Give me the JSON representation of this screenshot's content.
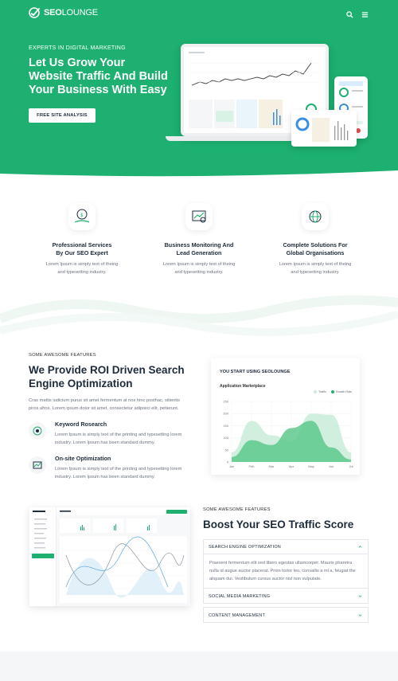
{
  "brand": {
    "name_prefix": "SEO",
    "name_suffix": "LOUNGE",
    "accent": "#1db070",
    "dark": "#1d2b3a"
  },
  "header": {
    "icons": [
      "search-icon",
      "menu-icon"
    ]
  },
  "hero": {
    "kicker": "EXPERTS IN DIGITAL MARKETING",
    "title": "Let Us Grow Your Website Traffic And Build Your Business With Easy",
    "cta": "FREE SITE ANALYSIS"
  },
  "features": [
    {
      "title_1": "Professional Services",
      "title_2": "By Our SEO Expert",
      "desc_1": "Lorem Ipsum is simply text of theing",
      "desc_2": "and typesetting industry.",
      "icon": "money-hand-icon"
    },
    {
      "title_1": "Business Monitoring And",
      "title_2": "Lead Generation",
      "desc_1": "Lorem Ipsum is simply text of theing",
      "desc_2": "and typesetting industry.",
      "icon": "monitoring-search-icon"
    },
    {
      "title_1": "Complete Solutions For",
      "title_2": "Global Organisations",
      "desc_1": "Lorem Ipsum is simply text of theing",
      "desc_2": "and typesetting industry.",
      "icon": "global-target-icon"
    }
  ],
  "roi": {
    "kicker": "SOME AWESOME FEATURES",
    "title_1": "We Provide ROI Driven Search",
    "title_2": "Engine Optimization",
    "para_1": "Cras mattis iudicium purus sit amet fermentum at nos hinc posthac, sitientis",
    "para_2": "piros afros. Lorem ipsum dolor sit amet, consectetur adipisici elit, petierunt.",
    "items": [
      {
        "title": "Keyword Rosearch",
        "desc_1": "Lorem Ipsum is simply text of the printing and typesetting lorem",
        "desc_2": "industry. Lorem Ipsum has been standard dummy.",
        "icon": "keyword-target-icon"
      },
      {
        "title": "On-site Optimization",
        "desc_1": "Lorem Ipsum is simply text of the printing and typesetting lorem",
        "desc_2": "industry. Lorem Ipsum has been standard dummy.",
        "icon": "onsite-chart-icon"
      }
    ]
  },
  "chart_card": {
    "heading": "YOU START USING SEOLOUNGE",
    "subtitle": "Application Marketplace"
  },
  "chart_data": {
    "type": "area",
    "title": "Application Marketplace",
    "categories": [
      "Jan",
      "Feb",
      "Mar",
      "Apr",
      "May",
      "Jun",
      "Jul"
    ],
    "ylim": [
      0,
      250
    ],
    "yticks": [
      0,
      50,
      100,
      150,
      200,
      250
    ],
    "legend_position": "top-right",
    "series": [
      {
        "name": "Traffic",
        "color": "#c9ecd9",
        "values": [
          40,
          170,
          110,
          85,
          200,
          195,
          40
        ]
      },
      {
        "name": "Growth Rate",
        "color": "#5ec98d",
        "values": [
          20,
          90,
          70,
          140,
          170,
          60,
          10
        ]
      }
    ]
  },
  "boost": {
    "kicker": "SOME AWESOME FEATURES",
    "title": "Boost Your SEO Traffic Score",
    "accordion": [
      {
        "label": "SEARCH ENGINE OPTIMIZATION",
        "open": true,
        "body_1": "Praesent fermentum elit sed libero egestas ullamcorper. Mauris pharetra",
        "body_2": "nulla id augue auctor placerat. Proin tortor leo, convallis a mi a, feugiat the",
        "body_3": "aliquam dui. Vestibulum cursus auctor nisl non vulputate."
      },
      {
        "label": "SOCIAL MEDIA MARKETING",
        "open": false
      },
      {
        "label": "CONTENT MANAGEMENT",
        "open": false
      }
    ]
  },
  "dashboard_mock": {
    "cta": "Upgrade To Pro"
  }
}
